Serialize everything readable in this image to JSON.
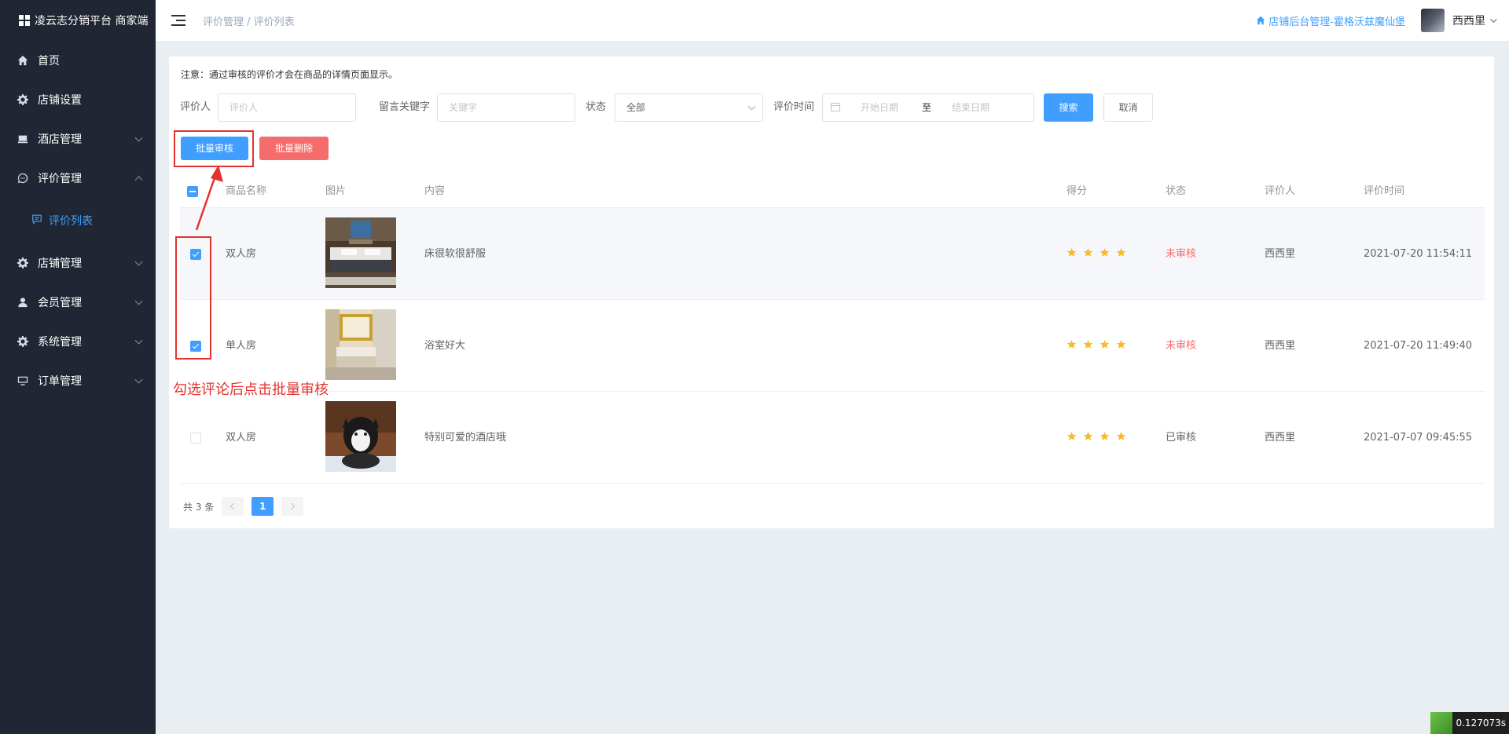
{
  "brand": {
    "title": "凌云志分销平台 商家端"
  },
  "sidebar": {
    "items": [
      {
        "label": "首页",
        "icon": "home-icon",
        "expandable": false
      },
      {
        "label": "店铺设置",
        "icon": "gear-icon",
        "expandable": false
      },
      {
        "label": "酒店管理",
        "icon": "hotel-icon",
        "expandable": true
      },
      {
        "label": "评价管理",
        "icon": "comment-icon",
        "expandable": true,
        "expanded": true
      },
      {
        "label": "店铺管理",
        "icon": "gear-icon",
        "expandable": true
      },
      {
        "label": "会员管理",
        "icon": "user-icon",
        "expandable": true
      },
      {
        "label": "系统管理",
        "icon": "gear-icon",
        "expandable": true
      },
      {
        "label": "订单管理",
        "icon": "monitor-icon",
        "expandable": true
      }
    ],
    "active_sub": {
      "label": "评价列表",
      "icon": "message-icon"
    }
  },
  "header": {
    "breadcrumb": "评价管理 / 评价列表",
    "store_link": "店铺后台管理-霍格沃兹魔仙堡",
    "username": "西西里"
  },
  "main": {
    "notice": "注意：通过审核的评价才会在商品的详情页面显示。",
    "filters": {
      "reviewer_label": "评价人",
      "reviewer_placeholder": "评价人",
      "keyword_label": "留言关键字",
      "keyword_placeholder": "关键字",
      "status_label": "状态",
      "status_value": "全部",
      "time_label": "评价时间",
      "start_placeholder": "开始日期",
      "range_sep": "至",
      "end_placeholder": "结束日期",
      "search_label": "搜索",
      "cancel_label": "取消"
    },
    "batch_review_label": "批量审核",
    "batch_delete_label": "批量删除",
    "table": {
      "columns": [
        "商品名称",
        "图片",
        "内容",
        "得分",
        "状态",
        "评价人",
        "评价时间"
      ],
      "rows": [
        {
          "checked": true,
          "name": "双人房",
          "content": "床很软很舒服",
          "score": 4,
          "status": "未审核",
          "reviewer": "西西里",
          "time": "2021-07-20 11:54:11"
        },
        {
          "checked": true,
          "name": "单人房",
          "content": "浴室好大",
          "score": 4,
          "status": "未审核",
          "reviewer": "西西里",
          "time": "2021-07-20 11:49:40"
        },
        {
          "checked": false,
          "name": "双人房",
          "content": "特别可爱的酒店哦",
          "score": 4,
          "status": "已审核",
          "reviewer": "西西里",
          "time": "2021-07-07 09:45:55"
        }
      ]
    },
    "pagination": {
      "total_text": "共 3 条",
      "current_page": "1"
    }
  },
  "annotation": {
    "text": "勾选评论后点击批量审核"
  },
  "timer": {
    "value": "0.127073s"
  },
  "colors": {
    "sidebar_bg": "#202633",
    "primary": "#409eff",
    "danger": "#f56c6c",
    "annotation": "#e5322d",
    "star": "#f7ba2a"
  }
}
